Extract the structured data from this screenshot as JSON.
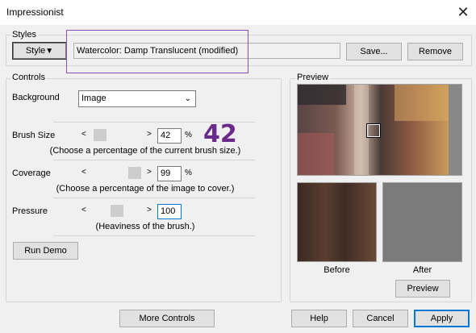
{
  "window": {
    "title": "Impressionist",
    "close_glyph": "✕"
  },
  "styles": {
    "group_label": "Styles",
    "style_button": "Style",
    "style_button_glyph": "▼",
    "current_style": "Watercolor: Damp Translucent (modified)",
    "save_button": "Save...",
    "remove_button": "Remove"
  },
  "controls": {
    "group_label": "Controls",
    "background_label": "Background",
    "background_value": "Image",
    "brush_size": {
      "label": "Brush Size",
      "value": "42",
      "unit": "%",
      "hint": "(Choose a percentage of the current brush size.)"
    },
    "coverage": {
      "label": "Coverage",
      "value": "99",
      "unit": "%",
      "hint": "(Choose a percentage of the image to cover.)"
    },
    "pressure": {
      "label": "Pressure",
      "value": "100",
      "hint": "(Heaviness of the brush.)"
    },
    "run_demo_button": "Run Demo"
  },
  "annotation": {
    "big_number": "42",
    "color": "#6a2a8a"
  },
  "preview": {
    "group_label": "Preview",
    "before_label": "Before",
    "after_label": "After",
    "preview_button": "Preview"
  },
  "footer": {
    "more_controls_button": "More Controls",
    "help_button": "Help",
    "cancel_button": "Cancel",
    "apply_button": "Apply"
  }
}
